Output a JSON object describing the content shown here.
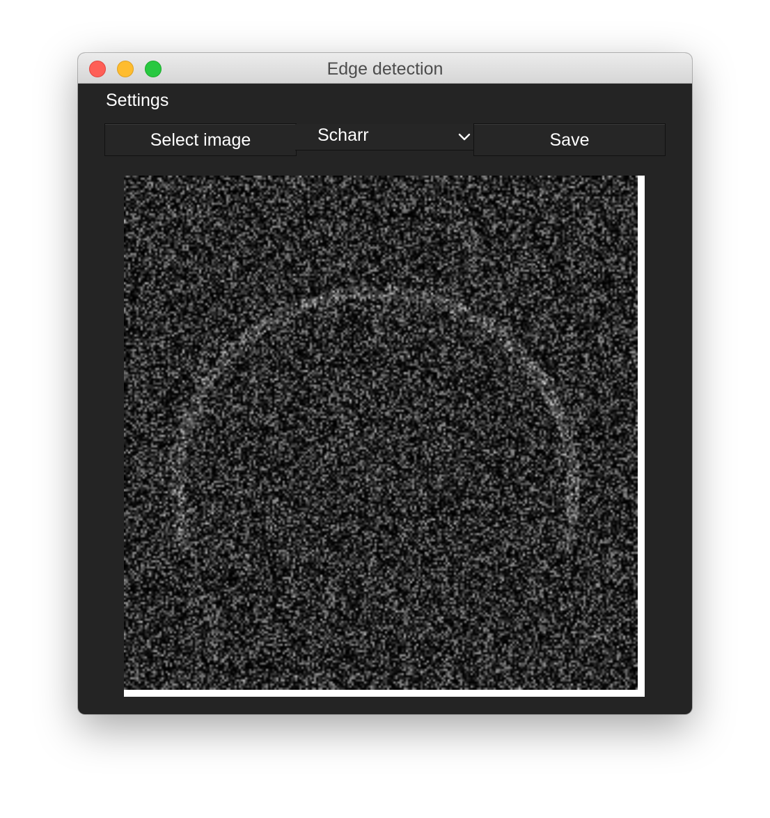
{
  "window": {
    "title": "Edge detection"
  },
  "menu": {
    "settings_label": "Settings"
  },
  "toolbar": {
    "select_image_label": "Select image",
    "method_selected": "Scharr",
    "save_label": "Save"
  },
  "preview": {
    "content": "edge-detection-result-image"
  },
  "colors": {
    "window_bg": "#242424",
    "close": "#fe5f57",
    "minimize": "#febc2e",
    "maximize": "#28c840"
  }
}
